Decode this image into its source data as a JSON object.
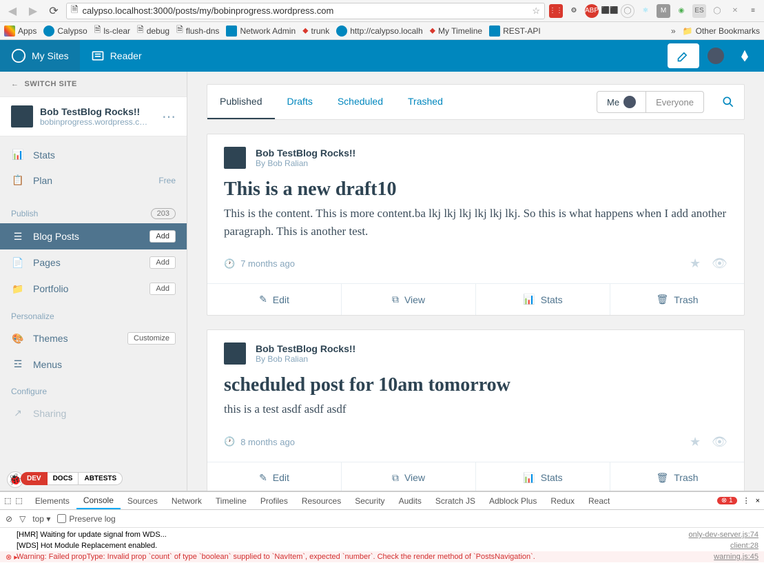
{
  "browser": {
    "url": "calypso.localhost:3000/posts/my/bobinprogress.wordpress.com",
    "bookmarks": [
      "Apps",
      "Calypso",
      "ls-clear",
      "debug",
      "flush-dns",
      "Network Admin",
      "trunk",
      "http://calypso.localh",
      "My Timeline",
      "REST-API"
    ],
    "other_bookmarks": "Other Bookmarks"
  },
  "masterbar": {
    "my_sites": "My Sites",
    "reader": "Reader"
  },
  "sidebar": {
    "switch_site": "SWITCH SITE",
    "site_title": "Bob TestBlog Rocks!!",
    "site_domain": "bobinprogress.wordpress.c…",
    "stats": "Stats",
    "plan": "Plan",
    "plan_badge": "Free",
    "publish_heading": "Publish",
    "publish_count": "203",
    "blog_posts": "Blog Posts",
    "pages": "Pages",
    "portfolio": "Portfolio",
    "add": "Add",
    "personalize_heading": "Personalize",
    "themes": "Themes",
    "customize": "Customize",
    "menus": "Menus",
    "configure_heading": "Configure",
    "sharing": "Sharing",
    "dev": "DEV",
    "docs": "DOCS",
    "abtests": "ABTESTS"
  },
  "nav": {
    "published": "Published",
    "drafts": "Drafts",
    "scheduled": "Scheduled",
    "trashed": "Trashed",
    "me": "Me",
    "everyone": "Everyone"
  },
  "posts": [
    {
      "site": "Bob TestBlog Rocks!!",
      "author": "By Bob Ralian",
      "title": "This is a new draft10",
      "excerpt": "This is the content. This is more content.ba lkj lkj lkj lkj  lkj lkj. So this is what happens when I add another paragraph. This is another test.",
      "time": "7 months ago"
    },
    {
      "site": "Bob TestBlog Rocks!!",
      "author": "By Bob Ralian",
      "title": "scheduled post for 10am tomorrow",
      "excerpt": "this is a test asdf asdf asdf",
      "time": "8 months ago"
    }
  ],
  "actions": {
    "edit": "Edit",
    "view": "View",
    "stats": "Stats",
    "trash": "Trash"
  },
  "devtools": {
    "tabs": [
      "Elements",
      "Console",
      "Sources",
      "Network",
      "Timeline",
      "Profiles",
      "Resources",
      "Security",
      "Audits",
      "Scratch JS",
      "Adblock Plus",
      "Redux",
      "React"
    ],
    "active_tab": "Console",
    "top": "top",
    "preserve": "Preserve log",
    "error_count": "1",
    "lines": [
      {
        "msg": "[HMR] Waiting for update signal from WDS...",
        "src": "only-dev-server.js:74",
        "type": "log"
      },
      {
        "msg": "[WDS] Hot Module Replacement enabled.",
        "src": "client:28",
        "type": "log"
      },
      {
        "msg": "Warning: Failed propType: Invalid prop `count` of type `boolean` supplied to `NavItem`, expected `number`. Check the render method of `PostsNavigation`.",
        "src": "warning.js:45",
        "type": "error"
      }
    ]
  }
}
